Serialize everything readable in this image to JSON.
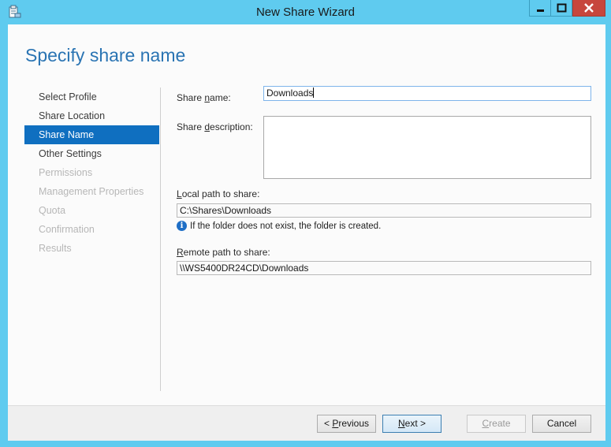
{
  "window": {
    "title": "New Share Wizard",
    "colors": {
      "frame": "#5fcbef",
      "accent": "#0f6fc0",
      "heading": "#2a74b3",
      "close": "#c7463d"
    }
  },
  "page": {
    "heading": "Specify share name"
  },
  "nav": {
    "items": [
      {
        "label": "Select Profile",
        "state": "enabled"
      },
      {
        "label": "Share Location",
        "state": "enabled"
      },
      {
        "label": "Share Name",
        "state": "active"
      },
      {
        "label": "Other Settings",
        "state": "enabled"
      },
      {
        "label": "Permissions",
        "state": "disabled"
      },
      {
        "label": "Management Properties",
        "state": "disabled"
      },
      {
        "label": "Quota",
        "state": "disabled"
      },
      {
        "label": "Confirmation",
        "state": "disabled"
      },
      {
        "label": "Results",
        "state": "disabled"
      }
    ]
  },
  "form": {
    "share_name": {
      "label_pre": "Share ",
      "label_key": "n",
      "label_post": "ame:",
      "value": "Downloads"
    },
    "share_description": {
      "label_pre": "Share ",
      "label_key": "d",
      "label_post": "escription:",
      "value": ""
    },
    "local_path": {
      "label_key": "L",
      "label_post": "ocal path to share:",
      "value": "C:\\Shares\\Downloads"
    },
    "info_text": "If the folder does not exist, the folder is created.",
    "remote_path": {
      "label_key": "R",
      "label_post": "emote path to share:",
      "value": "\\\\WS5400DR24CD\\Downloads"
    }
  },
  "footer": {
    "previous": {
      "pre": "< ",
      "key": "P",
      "post": "revious"
    },
    "next": {
      "key": "N",
      "post": "ext >"
    },
    "create": {
      "key": "C",
      "post": "reate"
    },
    "cancel": "Cancel"
  },
  "icons": [
    "wizard-app-icon",
    "minimize-icon",
    "maximize-icon",
    "close-icon",
    "info-icon"
  ]
}
